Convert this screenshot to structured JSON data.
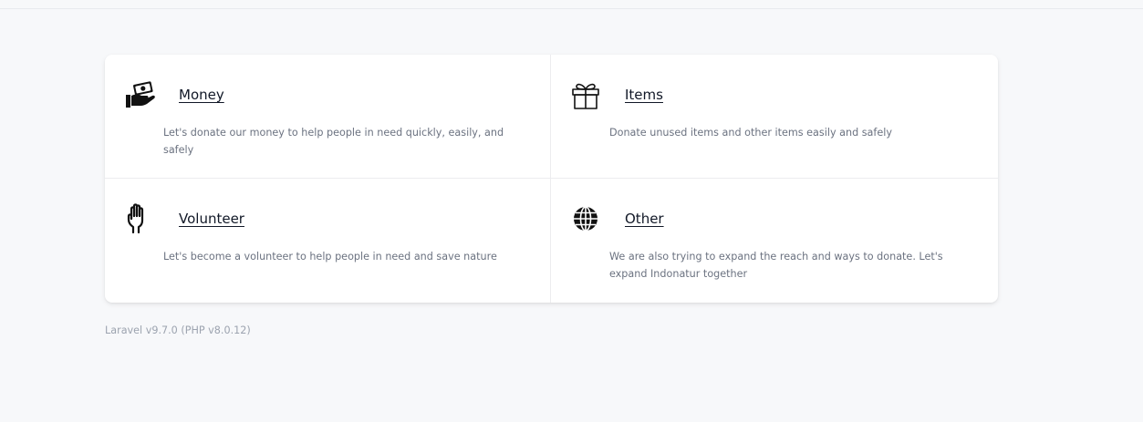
{
  "cards": [
    {
      "title": "Money",
      "description": "Let's donate our money to help people in need quickly, easily, and safely",
      "icon": "hand-money-icon"
    },
    {
      "title": "Items",
      "description": "Donate unused items and other items easily and safely",
      "icon": "gift-icon"
    },
    {
      "title": "Volunteer",
      "description": "Let's become a volunteer to help people in need and save nature",
      "icon": "raised-hand-icon"
    },
    {
      "title": "Other",
      "description": "We are also trying to expand the reach and ways to donate. Let's expand Indonatur together",
      "icon": "globe-icon"
    }
  ],
  "footer": {
    "version": "Laravel v9.7.0 (PHP v8.0.12)"
  }
}
